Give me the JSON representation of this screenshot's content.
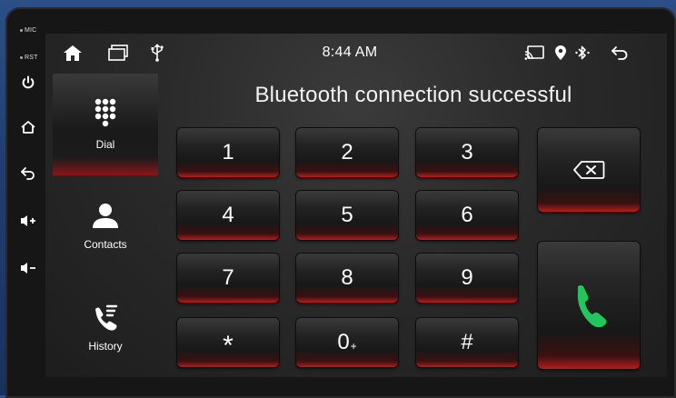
{
  "bezel": {
    "mic_label": "MIC",
    "rst_label": "RST"
  },
  "statusbar": {
    "time": "8:44 AM"
  },
  "sidebar": {
    "items": [
      {
        "label": "Dial",
        "icon": "dialpad-icon",
        "active": true
      },
      {
        "label": "Contacts",
        "icon": "person-icon",
        "active": false
      },
      {
        "label": "History",
        "icon": "call-log-icon",
        "active": false
      }
    ]
  },
  "main": {
    "title": "Bluetooth connection successful"
  },
  "keypad": {
    "keys": [
      "1",
      "2",
      "3",
      "4",
      "5",
      "6",
      "7",
      "8",
      "9",
      "*",
      "0",
      "#"
    ],
    "zero_sub": "+"
  },
  "colors": {
    "accent_red": "#b71c1c",
    "call_green": "#22c55e",
    "screen_bg": "#2a2a2a",
    "frame_blue": "#1f3f72"
  }
}
